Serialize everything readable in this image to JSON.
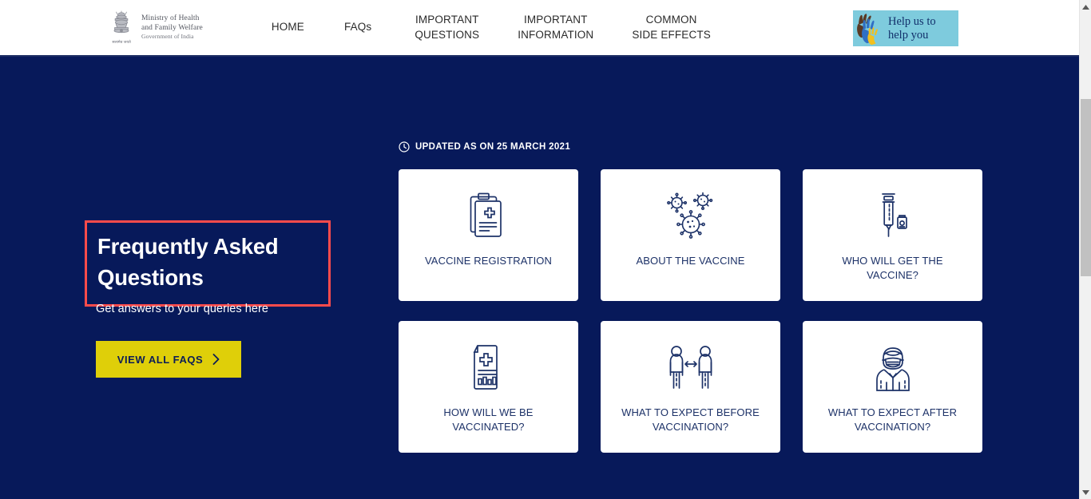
{
  "header": {
    "brand": {
      "emblem_name": "india-state-emblem",
      "line1": "Ministry of Health",
      "line2": "and Family Welfare",
      "line3": "Government of India",
      "emblem_caption": "सत्यमेव जयते"
    },
    "nav": [
      {
        "label": "HOME",
        "name": "nav-home"
      },
      {
        "label": "FAQs",
        "name": "nav-faqs"
      },
      {
        "label": "IMPORTANT\nQUESTIONS",
        "name": "nav-important-questions"
      },
      {
        "label": "IMPORTANT\nINFORMATION",
        "name": "nav-important-information"
      },
      {
        "label": "COMMON\nSIDE EFFECTS",
        "name": "nav-common-side-effects"
      }
    ],
    "help_badge": {
      "text": "Help us to\nhelp you",
      "icon": "three-hands-icon",
      "bg_color": "#7ecbdd",
      "text_color": "#12306b"
    }
  },
  "main": {
    "updated": {
      "icon": "clock-icon",
      "text": "UPDATED AS ON 25 MARCH 2021"
    },
    "hero": {
      "title": "Frequently Asked Questions",
      "subtitle": "Get answers to your queries here",
      "button_label": "VIEW ALL FAQS",
      "button_icon": "chevron-right-icon",
      "button_bg": "#dfcf09",
      "button_text_color": "#0c1d57",
      "highlight_color": "#ff4b4b"
    },
    "cards": [
      {
        "label": "VACCINE REGISTRATION",
        "icon": "clipboard-medical-icon",
        "name": "card-vaccine-registration"
      },
      {
        "label": "ABOUT THE VACCINE",
        "icon": "virus-particles-icon",
        "name": "card-about-the-vaccine"
      },
      {
        "label": "WHO WILL GET THE VACCINE?",
        "icon": "syringe-vial-icon",
        "name": "card-who-will-get-the-vaccine"
      },
      {
        "label": "HOW WILL WE BE VACCINATED?",
        "icon": "medical-document-icon",
        "name": "card-how-will-we-be-vaccinated"
      },
      {
        "label": "WHAT TO EXPECT BEFORE VACCINATION?",
        "icon": "social-distancing-icon",
        "name": "card-what-to-expect-before-vaccination"
      },
      {
        "label": "WHAT TO EXPECT AFTER VACCINATION?",
        "icon": "masked-person-icon",
        "name": "card-what-to-expect-after-vaccination"
      }
    ]
  },
  "theme": {
    "page_bg": "#07195a",
    "card_bg": "#ffffff",
    "icon_color": "#1d3268"
  }
}
